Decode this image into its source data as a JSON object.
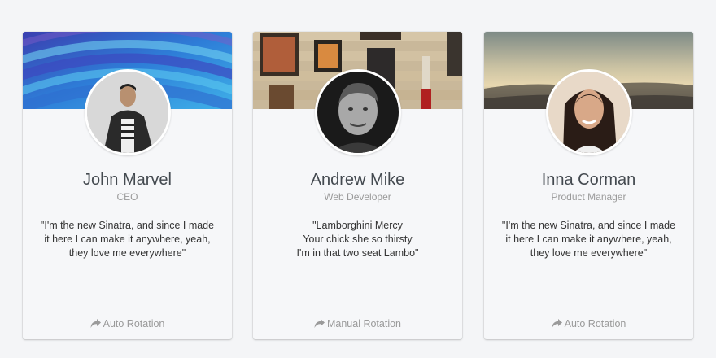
{
  "cards": [
    {
      "name": "John Marvel",
      "role": "CEO",
      "quote": [
        "\"I'm the new Sinatra, and since I made",
        "it here I can make it anywhere, yeah,",
        "they love me everywhere\""
      ],
      "action": "Auto Rotation",
      "action_icon": "share-icon"
    },
    {
      "name": "Andrew Mike",
      "role": "Web Developer",
      "quote": [
        "\"Lamborghini Mercy",
        "Your chick she so thirsty",
        "I'm in that two seat Lambo\""
      ],
      "action": "Manual Rotation",
      "action_icon": "share-icon"
    },
    {
      "name": "Inna Corman",
      "role": "Product Manager",
      "quote": [
        "\"I'm the new Sinatra, and since I made",
        "it here I can make it anywhere, yeah,",
        "they love me everywhere\""
      ],
      "action": "Auto Rotation",
      "action_icon": "share-icon"
    }
  ],
  "colors": {
    "page_background": "#f4f5f7",
    "card_background": "#f6f7f9",
    "name_text": "#444a50",
    "muted_text": "#9a9a9a"
  }
}
